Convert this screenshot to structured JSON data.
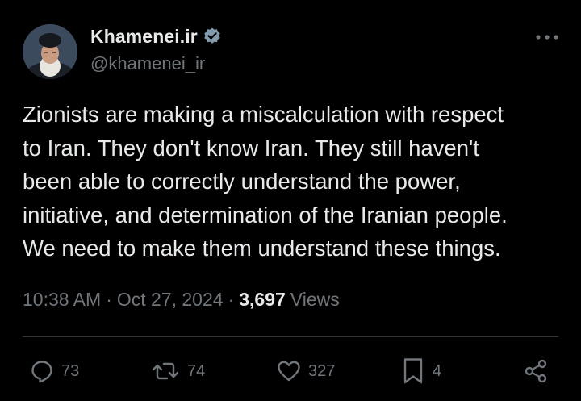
{
  "author": {
    "display_name": "Khamenei.ir",
    "handle": "@khamenei_ir",
    "verified": true,
    "verified_color": "#829aab"
  },
  "tweet": {
    "text": "Zionists are making a miscalculation with respect\nto Iran. They don't know Iran. They still haven't\nbeen able to correctly understand the power,\ninitiative, and determination of the Iranian people.\nWe need to make them understand these things.",
    "time": "10:38 AM",
    "separator": "·",
    "date": "Oct 27, 2024",
    "views_count": "3,697",
    "views_label": "Views"
  },
  "actions": {
    "replies": "73",
    "reposts": "74",
    "likes": "327",
    "bookmarks": "4"
  },
  "icons": {
    "more": "more-horizontal-icon",
    "reply": "reply-bubble-icon",
    "repost": "repost-icon",
    "like": "heart-icon",
    "bookmark": "bookmark-icon",
    "share": "share-icon",
    "verified": "verified-badge-icon"
  },
  "colors": {
    "background": "#000000",
    "primary_text": "#e7e9ea",
    "secondary_text": "#71767b",
    "divider": "#2f3336"
  }
}
